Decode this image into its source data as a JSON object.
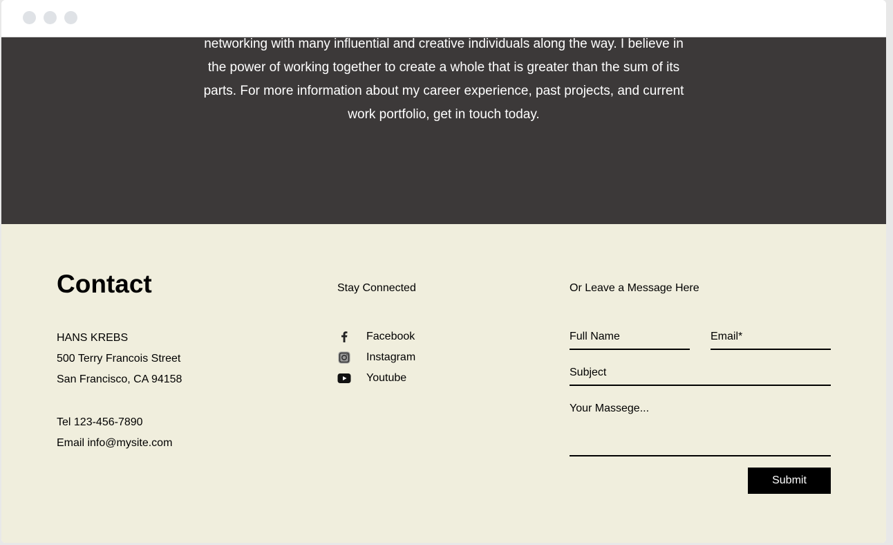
{
  "about": {
    "lines": [
      "networking with many influential and creative individuals along the way. I believe in",
      "the power of working together to create a whole that is greater than the sum of its",
      "parts. For more information about my career experience, past projects, and current",
      "work portfolio, get in touch today."
    ]
  },
  "contact": {
    "title": "Contact",
    "name": "HANS KREBS",
    "street": "500 Terry Francois Street",
    "city": "San Francisco, CA 94158",
    "tel": "Tel 123-456-7890",
    "email": "Email info@mysite.com"
  },
  "social": {
    "heading": "Stay Connected",
    "items": [
      {
        "label": "Facebook",
        "icon": "facebook-icon"
      },
      {
        "label": "Instagram",
        "icon": "instagram-icon"
      },
      {
        "label": "Youtube",
        "icon": "youtube-icon"
      }
    ]
  },
  "form": {
    "heading": "Or Leave a Message Here",
    "full_name_placeholder": "Full Name",
    "email_placeholder": "Email*",
    "subject_placeholder": "Subject",
    "message_placeholder": "Your Massege...",
    "submit_label": "Submit"
  },
  "colors": {
    "dark_bg": "#3c3939",
    "light_bg": "#f0eedd",
    "button_bg": "#000000"
  }
}
